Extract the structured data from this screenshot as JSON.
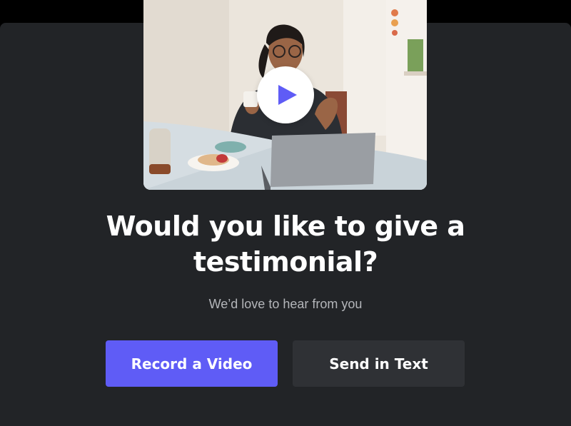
{
  "video": {
    "play_icon": "play-icon",
    "accent_color": "#5f5cf6"
  },
  "heading": {
    "line1": "Would you like to give a",
    "line2": "testimonial?"
  },
  "subtitle": "We’d love to hear from you",
  "actions": {
    "record_label": "Record a Video",
    "text_label": "Send in Text"
  },
  "colors": {
    "background": "#222427",
    "primary_button": "#5f5cf6",
    "secondary_button": "#2f3135"
  }
}
